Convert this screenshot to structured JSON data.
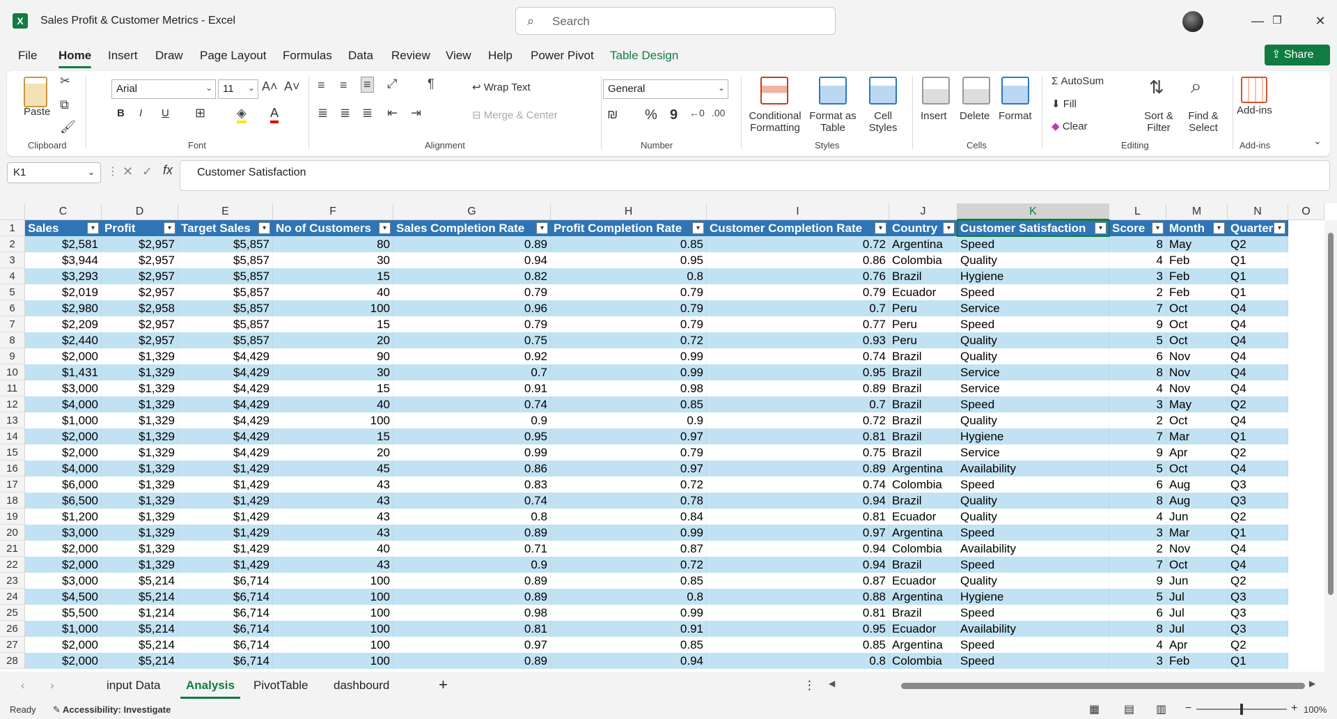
{
  "window": {
    "title": "Sales Profit & Customer Metrics  -  Excel",
    "app_letter": "X",
    "search_placeholder": "Search",
    "minimize": "—",
    "maximize": "❐",
    "close": "✕"
  },
  "menu": {
    "tabs": [
      "File",
      "Home",
      "Insert",
      "Draw",
      "Page Layout",
      "Formulas",
      "Data",
      "Review",
      "View",
      "Help",
      "Power Pivot",
      "Table Design"
    ],
    "active": "Home",
    "share": "Share"
  },
  "ribbon": {
    "clipboard": {
      "paste": "Paste",
      "label": "Clipboard"
    },
    "font": {
      "name": "Arial",
      "size": "11",
      "bold": "B",
      "italic": "I",
      "underline": "U",
      "label": "Font"
    },
    "alignment": {
      "wrap": "Wrap Text",
      "merge": "Merge & Center",
      "label": "Alignment"
    },
    "number": {
      "format": "General",
      "percent": "%",
      "comma": "9",
      "label": "Number"
    },
    "styles": {
      "conditional": [
        "Conditional",
        "Formatting"
      ],
      "format_table": [
        "Format as",
        "Table"
      ],
      "cell_styles": [
        "Cell",
        "Styles"
      ],
      "label": "Styles"
    },
    "cells": {
      "insert": "Insert",
      "delete": "Delete",
      "format": "Format",
      "label": "Cells"
    },
    "editing": {
      "autosum": "AutoSum",
      "fill": "Fill",
      "clear": "Clear",
      "sort": [
        "Sort &",
        "Filter"
      ],
      "find": [
        "Find &",
        "Select"
      ],
      "label": "Editing"
    },
    "addins": {
      "addins": "Add-ins",
      "label": "Add-ins"
    }
  },
  "formula_bar": {
    "name_box": "K1",
    "formula": "Customer Satisfaction"
  },
  "columns": [
    "C",
    "D",
    "E",
    "F",
    "G",
    "H",
    "I",
    "J",
    "K",
    "L",
    "M",
    "N",
    "O"
  ],
  "selected_column": "K",
  "table": {
    "headers": [
      "Sales",
      "Profit",
      "Target Sales",
      "No of Customers",
      "Sales Completion Rate",
      "Profit Completion Rate",
      "Customer Completion Rate",
      "Country",
      "Customer Satisfaction",
      "Score",
      "Month",
      "Quarter"
    ],
    "rows": [
      [
        "2",
        "$2,581",
        "$2,957",
        "$5,857",
        "80",
        "0.89",
        "0.85",
        "0.72",
        "Argentina",
        "Speed",
        "8",
        "May",
        "Q2"
      ],
      [
        "3",
        "$3,944",
        "$2,957",
        "$5,857",
        "30",
        "0.94",
        "0.95",
        "0.86",
        "Colombia",
        "Quality",
        "4",
        "Feb",
        "Q1"
      ],
      [
        "4",
        "$3,293",
        "$2,957",
        "$5,857",
        "15",
        "0.82",
        "0.8",
        "0.76",
        "Brazil",
        "Hygiene",
        "3",
        "Feb",
        "Q1"
      ],
      [
        "5",
        "$2,019",
        "$2,957",
        "$5,857",
        "40",
        "0.79",
        "0.79",
        "0.79",
        "Ecuador",
        "Speed",
        "2",
        "Feb",
        "Q1"
      ],
      [
        "6",
        "$2,980",
        "$2,958",
        "$5,857",
        "100",
        "0.96",
        "0.79",
        "0.7",
        "Peru",
        "Service",
        "7",
        "Oct",
        "Q4"
      ],
      [
        "7",
        "$2,209",
        "$2,957",
        "$5,857",
        "15",
        "0.79",
        "0.79",
        "0.77",
        "Peru",
        "Speed",
        "9",
        "Oct",
        "Q4"
      ],
      [
        "8",
        "$2,440",
        "$2,957",
        "$5,857",
        "20",
        "0.75",
        "0.72",
        "0.93",
        "Peru",
        "Quality",
        "5",
        "Oct",
        "Q4"
      ],
      [
        "9",
        "$2,000",
        "$1,329",
        "$4,429",
        "90",
        "0.92",
        "0.99",
        "0.74",
        "Brazil",
        "Quality",
        "6",
        "Nov",
        "Q4"
      ],
      [
        "10",
        "$1,431",
        "$1,329",
        "$4,429",
        "30",
        "0.7",
        "0.99",
        "0.95",
        "Brazil",
        "Service",
        "8",
        "Nov",
        "Q4"
      ],
      [
        "11",
        "$3,000",
        "$1,329",
        "$4,429",
        "15",
        "0.91",
        "0.98",
        "0.89",
        "Brazil",
        "Service",
        "4",
        "Nov",
        "Q4"
      ],
      [
        "12",
        "$4,000",
        "$1,329",
        "$4,429",
        "40",
        "0.74",
        "0.85",
        "0.7",
        "Brazil",
        "Speed",
        "3",
        "May",
        "Q2"
      ],
      [
        "13",
        "$1,000",
        "$1,329",
        "$4,429",
        "100",
        "0.9",
        "0.9",
        "0.72",
        "Brazil",
        "Quality",
        "2",
        "Oct",
        "Q4"
      ],
      [
        "14",
        "$2,000",
        "$1,329",
        "$4,429",
        "15",
        "0.95",
        "0.97",
        "0.81",
        "Brazil",
        "Hygiene",
        "7",
        "Mar",
        "Q1"
      ],
      [
        "15",
        "$2,000",
        "$1,329",
        "$4,429",
        "20",
        "0.99",
        "0.79",
        "0.75",
        "Brazil",
        "Service",
        "9",
        "Apr",
        "Q2"
      ],
      [
        "16",
        "$4,000",
        "$1,329",
        "$1,429",
        "45",
        "0.86",
        "0.97",
        "0.89",
        "Argentina",
        "Availability",
        "5",
        "Oct",
        "Q4"
      ],
      [
        "17",
        "$6,000",
        "$1,329",
        "$1,429",
        "43",
        "0.83",
        "0.72",
        "0.74",
        "Colombia",
        "Speed",
        "6",
        "Aug",
        "Q3"
      ],
      [
        "18",
        "$6,500",
        "$1,329",
        "$1,429",
        "43",
        "0.74",
        "0.78",
        "0.94",
        "Brazil",
        "Quality",
        "8",
        "Aug",
        "Q3"
      ],
      [
        "19",
        "$1,200",
        "$1,329",
        "$1,429",
        "43",
        "0.8",
        "0.84",
        "0.81",
        "Ecuador",
        "Quality",
        "4",
        "Jun",
        "Q2"
      ],
      [
        "20",
        "$3,000",
        "$1,329",
        "$1,429",
        "43",
        "0.89",
        "0.99",
        "0.97",
        "Argentina",
        "Speed",
        "3",
        "Mar",
        "Q1"
      ],
      [
        "21",
        "$2,000",
        "$1,329",
        "$1,429",
        "40",
        "0.71",
        "0.87",
        "0.94",
        "Colombia",
        "Availability",
        "2",
        "Nov",
        "Q4"
      ],
      [
        "22",
        "$2,000",
        "$1,329",
        "$1,429",
        "43",
        "0.9",
        "0.72",
        "0.94",
        "Brazil",
        "Speed",
        "7",
        "Oct",
        "Q4"
      ],
      [
        "23",
        "$3,000",
        "$5,214",
        "$6,714",
        "100",
        "0.89",
        "0.85",
        "0.87",
        "Ecuador",
        "Quality",
        "9",
        "Jun",
        "Q2"
      ],
      [
        "24",
        "$4,500",
        "$5,214",
        "$6,714",
        "100",
        "0.89",
        "0.8",
        "0.88",
        "Argentina",
        "Hygiene",
        "5",
        "Jul",
        "Q3"
      ],
      [
        "25",
        "$5,500",
        "$1,214",
        "$6,714",
        "100",
        "0.98",
        "0.99",
        "0.81",
        "Brazil",
        "Speed",
        "6",
        "Jul",
        "Q3"
      ],
      [
        "26",
        "$1,000",
        "$5,214",
        "$6,714",
        "100",
        "0.81",
        "0.91",
        "0.95",
        "Ecuador",
        "Availability",
        "8",
        "Jul",
        "Q3"
      ],
      [
        "27",
        "$2,000",
        "$5,214",
        "$6,714",
        "100",
        "0.97",
        "0.85",
        "0.85",
        "Argentina",
        "Speed",
        "4",
        "Apr",
        "Q2"
      ],
      [
        "28",
        "$2,000",
        "$5,214",
        "$6,714",
        "100",
        "0.89",
        "0.94",
        "0.8",
        "Colombia",
        "Speed",
        "3",
        "Feb",
        "Q1"
      ]
    ]
  },
  "sheets": {
    "tabs": [
      "input Data",
      "Analysis",
      "PivotTable",
      "dashbourd"
    ],
    "active": "Analysis",
    "add": "+"
  },
  "status": {
    "ready": "Ready",
    "accessibility": "Accessibility: Investigate",
    "zoom": "100%",
    "zoom_minus": "−",
    "zoom_plus": "+"
  },
  "colors": {
    "accent": "#107c41",
    "table_header": "#2f75b5",
    "band": "#c1e2f2"
  }
}
